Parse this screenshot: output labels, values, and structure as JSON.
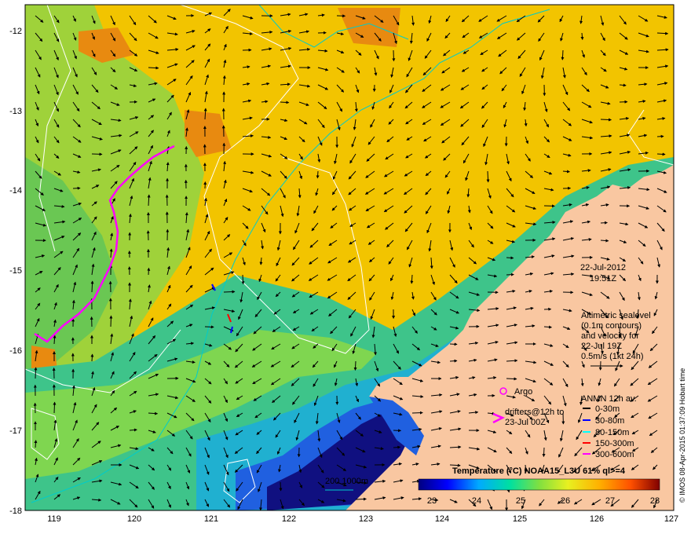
{
  "map": {
    "date": "22-Jul-2012",
    "time": "19:51Z",
    "lon_ticks": [
      "119",
      "120",
      "121",
      "122",
      "123",
      "124",
      "125",
      "126",
      "127"
    ],
    "lat_ticks": [
      "-12",
      "-13",
      "-14",
      "-15",
      "-16",
      "-17",
      "-18"
    ],
    "credit": "© IMOS 08-Apr-2015 01:37:09 Hobart time",
    "altimetry_text": [
      "Altimetric sealevel",
      "(0.1m contours)",
      "and velocity for",
      "22-Jul 19Z",
      "0.5m/s (1kt 24h)"
    ],
    "argo_label": "Argo",
    "drifters_label": [
      "drifters@12h to",
      "23-Jul 00Z"
    ],
    "anmn_title": "ANMN 12h av.",
    "anmn_items": [
      {
        "label": "0-30m",
        "color": "#000000"
      },
      {
        "label": "30-80m",
        "color": "#0000ff"
      },
      {
        "label": "80-150m",
        "color": "#00ffff"
      },
      {
        "label": "150-300m",
        "color": "#ff0000"
      },
      {
        "label": "300-600m",
        "color": "#ff00ff"
      }
    ],
    "isobath_label": "200  1000m",
    "colorbar_title": "Temperature (°C) NOAA15_L3U 61% ql>=4",
    "colorbar_ticks": [
      "23",
      "24",
      "25",
      "26",
      "27",
      "28"
    ],
    "colors": {
      "land": "#f9c7a1",
      "drifter": "#ff00ff",
      "isobath": "#00cccc",
      "contour": "#ffffff"
    }
  }
}
